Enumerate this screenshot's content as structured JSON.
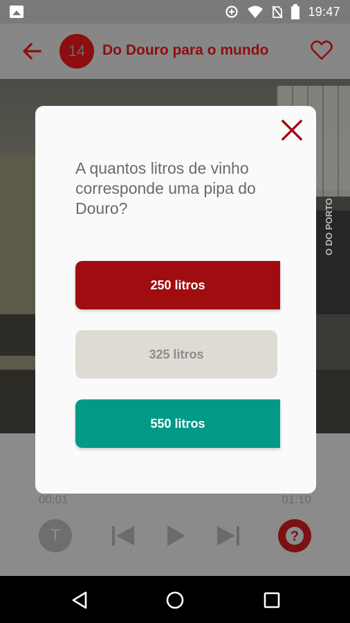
{
  "status_bar": {
    "time": "19:47",
    "icons": [
      "image-icon",
      "data-saver-icon",
      "wifi-icon",
      "no-sim-icon",
      "battery-icon"
    ]
  },
  "app_bar": {
    "track_number": "14",
    "title": "Do Douro para o mundo",
    "icons": [
      "arrow-back-icon",
      "heart-outline-icon"
    ]
  },
  "background_photo": {
    "banner_text": "O DO PORTO"
  },
  "player": {
    "elapsed": "00:01",
    "duration": "01:10",
    "text_button": "T",
    "icons": [
      "skip-previous-icon",
      "play-icon",
      "skip-next-icon",
      "help-icon"
    ]
  },
  "quiz": {
    "question": "A quantos litros de vinho corresponde uma pipa do Douro?",
    "answers": [
      {
        "label": "250 litros"
      },
      {
        "label": "325 litros"
      },
      {
        "label": "550 litros"
      }
    ],
    "close_icon": "close-icon"
  },
  "nav_bar": {
    "icons": [
      "back-triangle-icon",
      "home-circle-icon",
      "recents-square-icon"
    ]
  },
  "colors": {
    "brand_red": "#a00d10",
    "teal": "#009a87",
    "disabled_gray": "#dddbd3",
    "scrim_gray": "#878787"
  }
}
